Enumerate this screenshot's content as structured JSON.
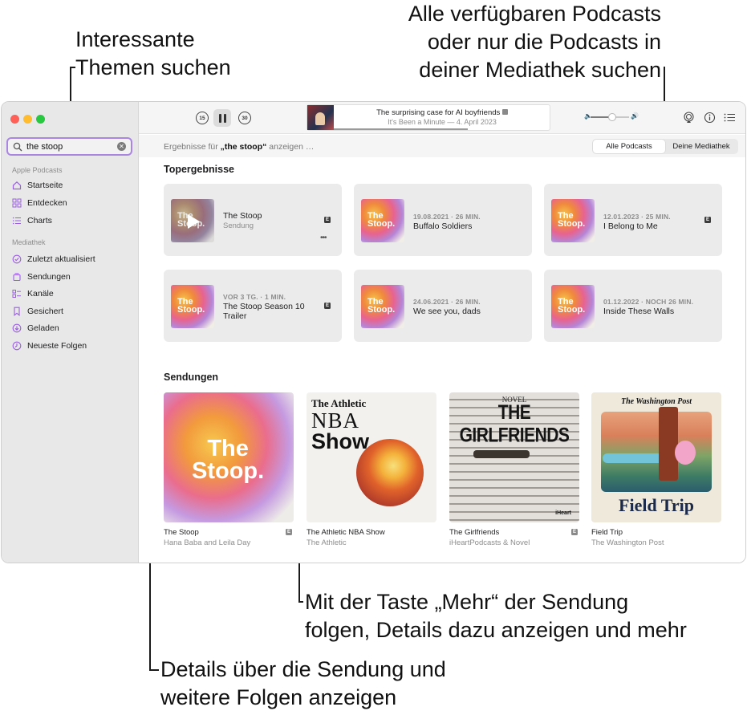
{
  "callouts": {
    "search_topics": "Interessante\nThemen suchen",
    "scope": "Alle verfügbaren Podcasts\noder nur die Podcasts in\ndeiner Mediathek suchen",
    "more_button": "Mit der Taste „Mehr“ der Sendung\nfolgen, Details dazu anzeigen und mehr",
    "show_details": "Details über die Sendung und\nweitere Folgen anzeigen"
  },
  "search": {
    "value": "the stoop",
    "icon": "magnifier-icon"
  },
  "sidebar": {
    "apple_heading": "Apple Podcasts",
    "apple_items": [
      {
        "label": "Startseite",
        "icon": "home-icon"
      },
      {
        "label": "Entdecken",
        "icon": "grid-icon"
      },
      {
        "label": "Charts",
        "icon": "list-icon"
      }
    ],
    "library_heading": "Mediathek",
    "library_items": [
      {
        "label": "Zuletzt aktualisiert",
        "icon": "clock-check-icon"
      },
      {
        "label": "Sendungen",
        "icon": "stack-icon"
      },
      {
        "label": "Kanäle",
        "icon": "channels-icon"
      },
      {
        "label": "Gesichert",
        "icon": "bookmark-icon"
      },
      {
        "label": "Geladen",
        "icon": "download-icon"
      },
      {
        "label": "Neueste Folgen",
        "icon": "history-icon"
      }
    ]
  },
  "player": {
    "skip_back": "15",
    "skip_forward": "30",
    "episode_title": "The surprising case for AI boyfriends",
    "episode_sub": "It's Been a Minute — 4. April 2023",
    "progress": 0.62,
    "volume": 0.55
  },
  "results": {
    "prefix": "Ergebnisse für ",
    "query": "„the stoop“",
    "suffix": " anzeigen …",
    "scope_options": [
      "Alle Podcasts",
      "Deine Mediathek"
    ],
    "scope_selected": "Alle Podcasts"
  },
  "top_results": {
    "title": "Topergebnisse",
    "cards": [
      {
        "meta": "",
        "title": "The Stoop",
        "sub": "Sendung",
        "explicit": "E",
        "art": "The\nStoop."
      },
      {
        "meta": "19.08.2021 · 26 MIN.",
        "title": "Buffalo Soldiers",
        "sub": "",
        "explicit": "",
        "art": "The\nStoop."
      },
      {
        "meta": "12.01.2023 · 25 MIN.",
        "title": "I Belong to Me",
        "sub": "",
        "explicit": "E",
        "art": "The\nStoop."
      },
      {
        "meta": "VOR 3 TG. · 1 MIN.",
        "title": "The Stoop Season 10 Trailer",
        "sub": "",
        "explicit": "E",
        "art": "The\nStoop."
      },
      {
        "meta": "24.06.2021 · 26 MIN.",
        "title": "We see you, dads",
        "sub": "",
        "explicit": "",
        "art": "The\nStoop."
      },
      {
        "meta": "01.12.2022 · NOCH 26 MIN.",
        "title": "Inside These Walls",
        "sub": "",
        "explicit": "",
        "art": "The\nStoop."
      }
    ]
  },
  "shows": {
    "title": "Sendungen",
    "items": [
      {
        "name": "The Stoop",
        "author": "Hana Baba and Leila Day",
        "explicit": "E",
        "art_text": "The\nStoop."
      },
      {
        "name": "The Athletic NBA Show",
        "author": "The Athletic",
        "explicit": "",
        "art_line1": "The Athletic",
        "art_line2": "NBA",
        "art_line3": "Show"
      },
      {
        "name": "The Girlfriends",
        "author": "iHeartPodcasts & Novel",
        "explicit": "E",
        "art_top": "NOVEL",
        "art_title": "THE GIRLFRIENDS",
        "art_brand": "iHeart"
      },
      {
        "name": "Field Trip",
        "author": "The Washington Post",
        "explicit": "",
        "art_top": "The Washington Post",
        "art_title": "Field Trip"
      }
    ]
  },
  "colors": {
    "accent": "#a987e0",
    "sidebar_bg": "#e8e8e8",
    "card_bg": "#ebebeb"
  }
}
